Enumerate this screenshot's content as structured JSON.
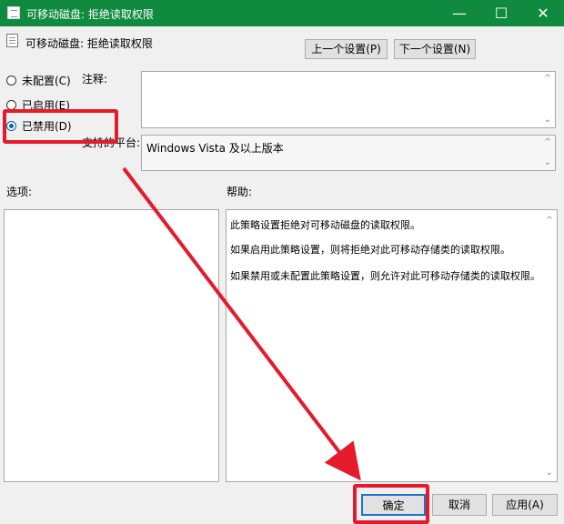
{
  "window": {
    "title": "可移动磁盘: 拒绝读取权限",
    "controls": [
      "minimize-icon",
      "maximize-icon",
      "close-icon"
    ]
  },
  "policy": {
    "title": "可移动磁盘: 拒绝读取权限",
    "prev_button": "上一个设置(P)",
    "next_button": "下一个设置(N)"
  },
  "state": {
    "options": [
      {
        "label": "未配置(C)",
        "selected": false
      },
      {
        "label": "已启用(E)",
        "selected": false
      },
      {
        "label": "已禁用(D)",
        "selected": true
      }
    ]
  },
  "fields": {
    "note_label": "注释:",
    "support_label": "支持的平台:",
    "support_value": "Windows Vista 及以上版本"
  },
  "sections": {
    "options_label": "选项:",
    "help_label": "帮助:"
  },
  "help": {
    "lines": [
      "此策略设置拒绝对可移动磁盘的读取权限。",
      "如果启用此策略设置，则将拒绝对此可移动存储类的读取权限。",
      "如果禁用或未配置此策略设置，则允许对此可移动存储类的读取权限。"
    ]
  },
  "buttons": {
    "ok": "确定",
    "cancel": "取消",
    "apply": "应用(A)"
  },
  "colors": {
    "title_bar": "#0f8a3e",
    "annotation": "#e31b2d",
    "selected_radio": "#0063b1"
  }
}
